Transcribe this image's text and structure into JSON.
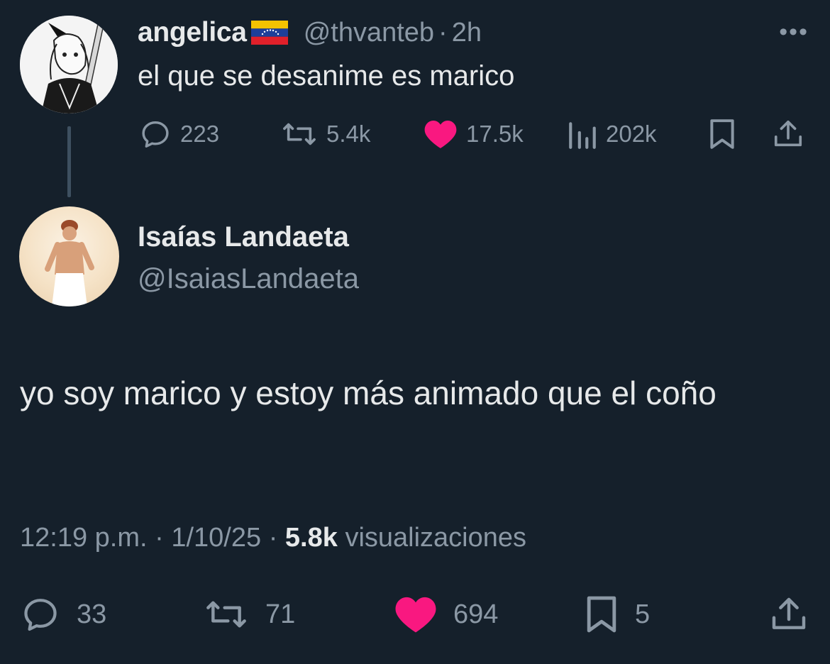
{
  "parent": {
    "name": "angelica",
    "handle": "@thvanteb",
    "separator": "·",
    "time": "2h",
    "more": "•••",
    "text": "el que se desanime es marico",
    "stats": {
      "replies": "223",
      "reposts": "5.4k",
      "likes": "17.5k",
      "views": "202k"
    },
    "flag_colors": [
      "#f4c300",
      "#1d3f99",
      "#e0202a"
    ]
  },
  "reply": {
    "name": "Isaías Landaeta",
    "handle": "@IsaiasLandaeta",
    "text": "yo soy marico y estoy más animado que el coño",
    "time": "12:19 p.m.",
    "date": "1/10/25",
    "views_count": "5.8k",
    "views_label": "visualizaciones",
    "separator": "·",
    "stats": {
      "replies": "33",
      "reposts": "71",
      "likes": "694",
      "bookmarks": "5"
    }
  },
  "theme": {
    "background": "#15202b",
    "text": "#e7e9ea",
    "muted": "#8b98a5",
    "like": "#f91880"
  },
  "icons": [
    "reply-icon",
    "repost-icon",
    "like-icon",
    "views-icon",
    "bookmark-icon",
    "share-icon",
    "more-icon"
  ]
}
